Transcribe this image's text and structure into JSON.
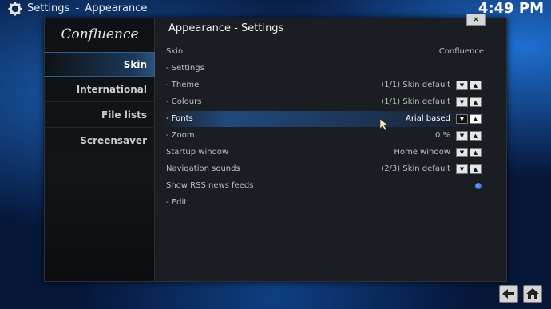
{
  "header": {
    "settings_label": "Settings",
    "separator": "-",
    "section_label": "Appearance",
    "clock": "4:49 PM"
  },
  "window": {
    "close_glyph": "✕",
    "title": "Appearance - Settings",
    "logo_text": "Confluence"
  },
  "sidebar": {
    "items": [
      {
        "label": "Skin",
        "active": true
      },
      {
        "label": "International",
        "active": false
      },
      {
        "label": "File lists",
        "active": false
      },
      {
        "label": "Screensaver",
        "active": false
      }
    ]
  },
  "settings": {
    "rows": [
      {
        "label": "Skin",
        "value": "Confluence",
        "control": "none"
      },
      {
        "label": "- Settings",
        "value": "",
        "control": "none"
      },
      {
        "label": "- Theme",
        "value": "(1/1) Skin default",
        "control": "spin"
      },
      {
        "label": "- Colours",
        "value": "(1/1) Skin default",
        "control": "spin"
      },
      {
        "label": "- Fonts",
        "value": "Arial based",
        "control": "spin",
        "focused": true
      },
      {
        "label": "- Zoom",
        "value": "0 %",
        "control": "spin"
      },
      {
        "label": "Startup window",
        "value": "Home window",
        "control": "spin"
      },
      {
        "label": "Navigation sounds",
        "value": "(2/3) Skin default",
        "control": "spin"
      },
      {
        "label": "Show RSS news feeds",
        "value": "",
        "control": "radio",
        "enabled": true
      },
      {
        "label": "- Edit",
        "value": "",
        "control": "none"
      }
    ]
  },
  "icons": {
    "gear": "gear-icon",
    "back": "back-arrow-icon",
    "home": "home-icon",
    "spin_down": "▼",
    "spin_up": "▲"
  },
  "colors": {
    "accent": "#2e6fc2",
    "background": "#06173a",
    "panel": "#1a1d22"
  }
}
